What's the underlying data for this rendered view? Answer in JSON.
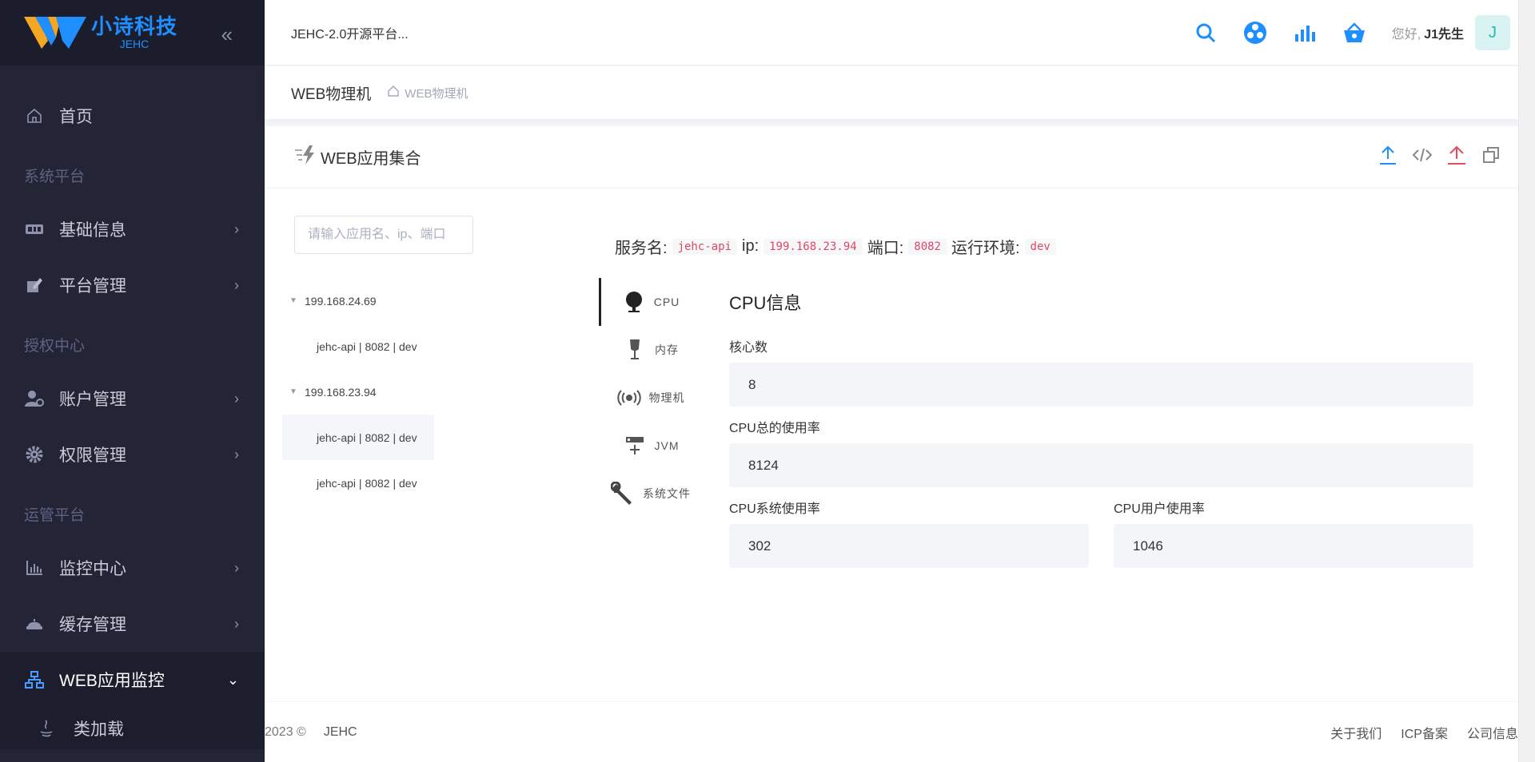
{
  "brand": {
    "name": "小诗科技",
    "sub": "JEHC"
  },
  "sidebar": {
    "collapse_icon": "double-chevron-left-icon",
    "items": [
      {
        "type": "item",
        "label": "首页",
        "icon": "home-icon"
      },
      {
        "type": "section",
        "label": "系统平台"
      },
      {
        "type": "item",
        "label": "基础信息",
        "icon": "id-card-icon"
      },
      {
        "type": "item",
        "label": "平台管理",
        "icon": "edit-icon"
      },
      {
        "type": "section",
        "label": "授权中心"
      },
      {
        "type": "item",
        "label": "账户管理",
        "icon": "user-gear-icon"
      },
      {
        "type": "item",
        "label": "权限管理",
        "icon": "gear-icon"
      },
      {
        "type": "section",
        "label": "运管平台"
      },
      {
        "type": "item",
        "label": "监控中心",
        "icon": "chart-icon"
      },
      {
        "type": "item",
        "label": "缓存管理",
        "icon": "cache-icon"
      },
      {
        "type": "item",
        "label": "WEB应用监控",
        "icon": "network-icon",
        "active": true
      },
      {
        "type": "sub",
        "label": "类加载",
        "icon": "java-icon"
      }
    ]
  },
  "topbar": {
    "title": "JEHC-2.0开源平台...",
    "greeting": "您好,",
    "username": "J1先生",
    "avatar_letter": "J"
  },
  "breadcrumb": {
    "title": "WEB物理机",
    "path": "WEB物理机"
  },
  "card": {
    "title": "WEB应用集合",
    "search_placeholder": "请输入应用名、ip、端口",
    "tree": [
      {
        "label": "199.168.24.69",
        "children": [
          {
            "label": "jehc-api | 8082 | dev"
          }
        ]
      },
      {
        "label": "199.168.23.94",
        "children": [
          {
            "label": "jehc-api | 8082 | dev",
            "selected": true
          },
          {
            "label": "jehc-api | 8082 | dev"
          }
        ]
      }
    ],
    "service": {
      "name_label": "服务名:",
      "name": "jehc-api",
      "ip_label": "ip:",
      "ip": "199.168.23.94",
      "port_label": "端口:",
      "port": "8082",
      "env_label": "运行环境:",
      "env": "dev"
    },
    "tabs": [
      {
        "label": "CPU",
        "icon": "cpu-icon"
      },
      {
        "label": "内存",
        "icon": "memory-icon"
      },
      {
        "label": "物理机",
        "icon": "broadcast-icon"
      },
      {
        "label": "JVM",
        "icon": "server-icon"
      },
      {
        "label": "系统文件",
        "icon": "wrench-icon"
      }
    ],
    "panel": {
      "title": "CPU信息",
      "cores_label": "核心数",
      "cores": "8",
      "total_label": "CPU总的使用率",
      "total": "8124",
      "sys_label": "CPU系统使用率",
      "sys": "302",
      "user_label": "CPU用户使用率",
      "user": "1046"
    }
  },
  "footer": {
    "copy": "2023 ©",
    "brand": "JEHC",
    "links": [
      "关于我们",
      "ICP备案",
      "公司信息"
    ]
  },
  "colors": {
    "sidebar_bg": "#232537",
    "brand_blue": "#1f8fff",
    "code_red": "#e04765"
  }
}
